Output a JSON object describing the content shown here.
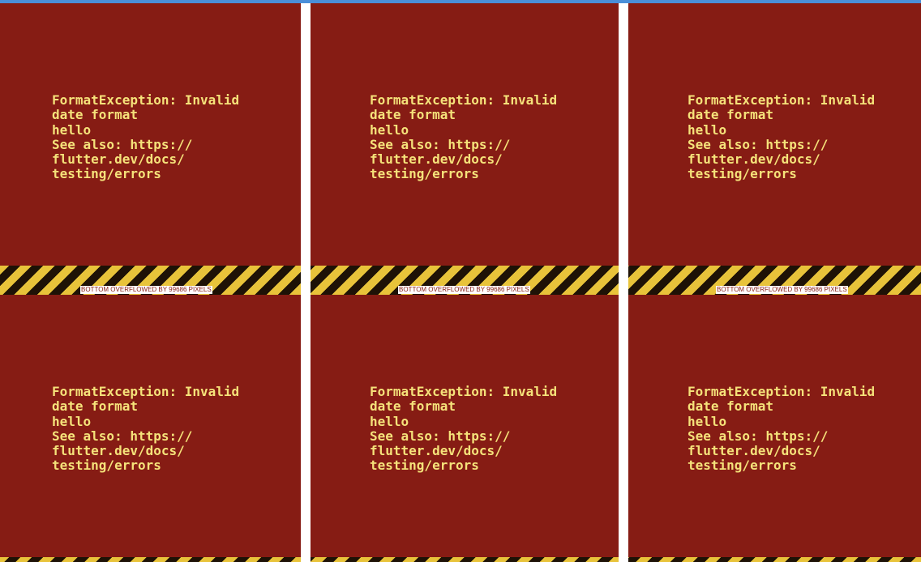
{
  "error_message": "FormatException: Invalid\ndate format\nhello\nSee also: https://\nflutter.dev/docs/\ntesting/errors",
  "overflow_label": "BOTTOM OVERFLOWED BY 99686 PIXELS",
  "colors": {
    "error_background": "#861c14",
    "error_text": "#f5e27a",
    "stripe_yellow": "#e8c33a",
    "stripe_dark": "#1e1206",
    "top_bar": "#4a8fd9"
  }
}
